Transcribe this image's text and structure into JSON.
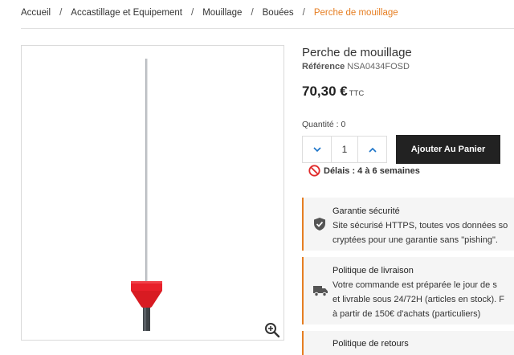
{
  "breadcrumb": {
    "items": [
      "Accueil",
      "Accastillage et Equipement",
      "Mouillage",
      "Bouées"
    ],
    "current": "Perche de mouillage",
    "separator": "/"
  },
  "product": {
    "title": "Perche de mouillage",
    "reference_label": "Référence",
    "reference_value": "NSA0434FOSD",
    "price": "70,30 €",
    "price_suffix": "TTC"
  },
  "quantity": {
    "label": "Quantité : 0",
    "value": "1"
  },
  "cart": {
    "add_label": "Ajouter Au Panier"
  },
  "delay": {
    "text": "Délais : 4 à 6 semaines"
  },
  "info_blocks": [
    {
      "title": "Garantie sécurité",
      "lines": [
        "Site sécurisé HTTPS, toutes vos données so",
        "cryptées pour une garantie sans \"pishing\"."
      ],
      "icon": "shield-check-icon"
    },
    {
      "title": "Politique de livraison",
      "lines": [
        "Votre commande est préparée le jour de s",
        "et livrable sous 24/72H (articles en stock). F",
        "à partir de 150€ d'achats (particuliers)"
      ],
      "icon": "truck-icon"
    },
    {
      "title": "Politique de retours",
      "lines": [],
      "icon": "return-icon"
    }
  ],
  "colors": {
    "accent": "#e67e22",
    "button_bg": "#222222",
    "buoy_red": "#e8202a"
  }
}
